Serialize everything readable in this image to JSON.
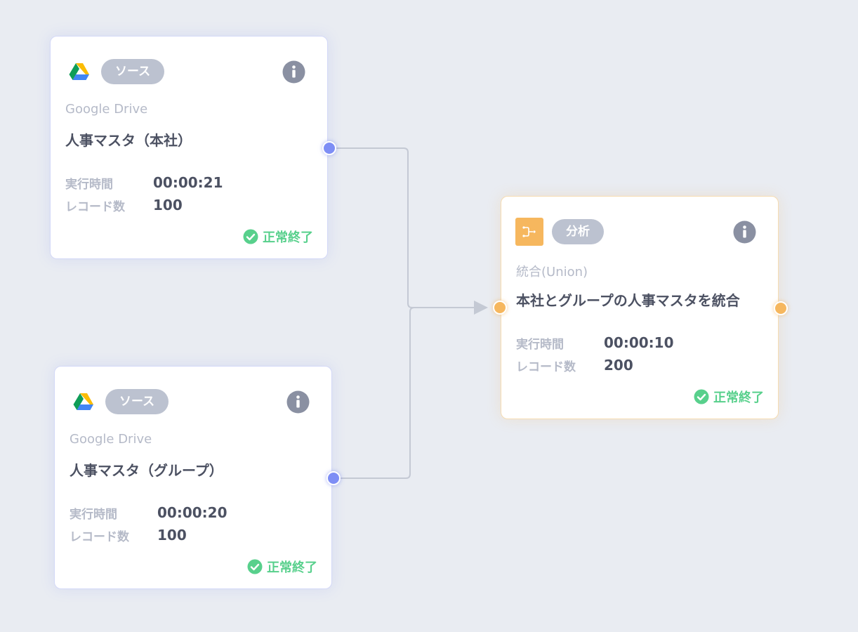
{
  "nodes": [
    {
      "badge": "ソース",
      "icon": "google-drive-icon",
      "type": "Google Drive",
      "title": "人事マスタ（本社）",
      "stats": [
        {
          "label": "実行時間",
          "value": "00:00:21"
        },
        {
          "label": "レコード数",
          "value": "100"
        }
      ],
      "status": "正常終了"
    },
    {
      "badge": "ソース",
      "icon": "google-drive-icon",
      "type": "Google Drive",
      "title": "人事マスタ（グループ）",
      "stats": [
        {
          "label": "実行時間",
          "value": "00:00:20"
        },
        {
          "label": "レコード数",
          "value": "100"
        }
      ],
      "status": "正常終了"
    },
    {
      "badge": "分析",
      "icon": "union-icon",
      "type": "統合(Union)",
      "title": "本社とグループの人事マスタを統合",
      "stats": [
        {
          "label": "実行時間",
          "value": "00:00:10"
        },
        {
          "label": "レコード数",
          "value": "200"
        }
      ],
      "status": "正常終了"
    }
  ],
  "colors": {
    "canvas": "#e9ecf2",
    "source_port": "#7e8ef5",
    "analysis_accent": "#f6b75e",
    "success": "#58d08c",
    "badge": "#bcc2d0",
    "connector": "#c4c9d4"
  }
}
